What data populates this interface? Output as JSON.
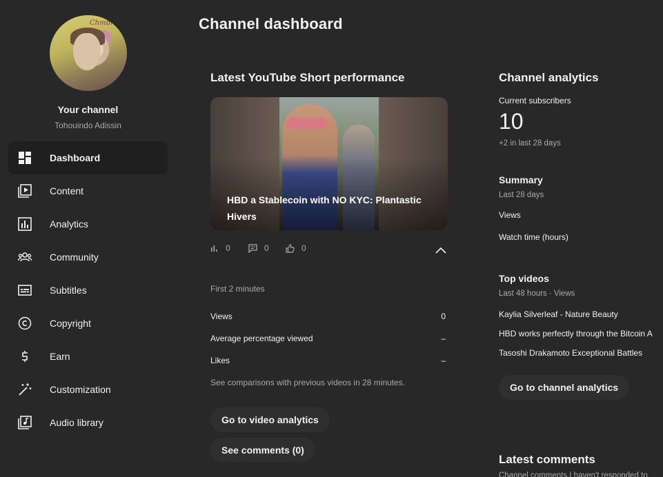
{
  "sidebar": {
    "channel_title": "Your channel",
    "channel_name": "Tohouindo Adissin",
    "avatar_signature": "Chmbra",
    "items": [
      {
        "label": "Dashboard",
        "icon": "dashboard-icon",
        "active": true
      },
      {
        "label": "Content",
        "icon": "content-icon"
      },
      {
        "label": "Analytics",
        "icon": "analytics-icon"
      },
      {
        "label": "Community",
        "icon": "community-icon"
      },
      {
        "label": "Subtitles",
        "icon": "subtitles-icon"
      },
      {
        "label": "Copyright",
        "icon": "copyright-icon"
      },
      {
        "label": "Earn",
        "icon": "earn-icon"
      },
      {
        "label": "Customization",
        "icon": "customization-icon"
      },
      {
        "label": "Audio library",
        "icon": "audio-library-icon"
      }
    ]
  },
  "header": {
    "title": "Channel dashboard"
  },
  "short_card": {
    "title": "Latest YouTube Short performance",
    "video_title": "HBD a Stablecoin with NO KYC: Plantastic Hivers",
    "stats": {
      "views": "0",
      "comments": "0",
      "likes": "0"
    },
    "period": "First 2 minutes",
    "metrics": [
      {
        "label": "Views",
        "value": "0"
      },
      {
        "label": "Average percentage viewed",
        "value": "–"
      },
      {
        "label": "Likes",
        "value": "–"
      }
    ],
    "comparison_note": "See comparisons with previous videos in 28 minutes.",
    "video_analytics_button": "Go to video analytics",
    "comments_button": "See comments (0)"
  },
  "analytics_card": {
    "title": "Channel analytics",
    "subscribers_label": "Current subscribers",
    "subscribers_value": "10",
    "subscribers_change": "+2 in last 28 days",
    "summary_title": "Summary",
    "summary_period": "Last 28 days",
    "summary_rows": [
      {
        "label": "Views"
      },
      {
        "label": "Watch time (hours)"
      }
    ],
    "top_videos_title": "Top videos",
    "top_videos_period": "Last 48 hours · Views",
    "top_videos": [
      "Kaylia Silverleaf - Nature Beauty",
      "HBD works perfectly through the Bitcoin A",
      "Tasoshi Drakamoto Exceptional Battles"
    ],
    "channel_analytics_button": "Go to channel analytics"
  },
  "comments_card": {
    "title": "Latest comments",
    "subtitle": "Channel comments I haven't responded to"
  },
  "colors": {
    "background": "#282828",
    "active_item": "#1f1f1f",
    "button": "#2f2f2f",
    "muted_text": "#aaaaaa"
  }
}
